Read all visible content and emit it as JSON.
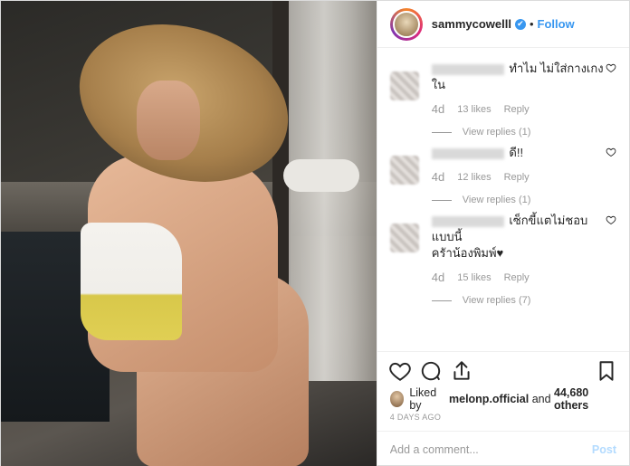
{
  "header": {
    "username": "sammycowelll",
    "verified_glyph": "✔",
    "separator": "•",
    "follow_label": "Follow"
  },
  "comments": [
    {
      "text_line1": "ทำไม ไม่ใส่กางเกง",
      "text_line2": "ใน",
      "age": "4d",
      "likes": "13 likes",
      "reply_label": "Reply",
      "replies_label": "View replies (1)"
    },
    {
      "text_line1": "ดี!!",
      "text_line2": "",
      "age": "4d",
      "likes": "12 likes",
      "reply_label": "Reply",
      "replies_label": "View replies (1)"
    },
    {
      "text_line1": "เซ็กขี้แตไม่ชอบแบบนี้",
      "text_line2": "ครัาน้องพิมพ์♥",
      "age": "4d",
      "likes": "15 likes",
      "reply_label": "Reply",
      "replies_label": "View replies (7)"
    }
  ],
  "likes": {
    "prefix": "Liked by",
    "user": "melonp.official",
    "joiner": "and",
    "count": "44,680 others"
  },
  "timestamp": "4 DAYS AGO",
  "add_comment": {
    "placeholder": "Add a comment...",
    "post_label": "Post"
  },
  "icons": {
    "like": "heart-icon",
    "comment": "comment-icon",
    "share": "share-icon",
    "save": "bookmark-icon"
  },
  "colors": {
    "accent": "#3897f0",
    "post_disabled": "#b3dbff",
    "muted": "#999999"
  }
}
